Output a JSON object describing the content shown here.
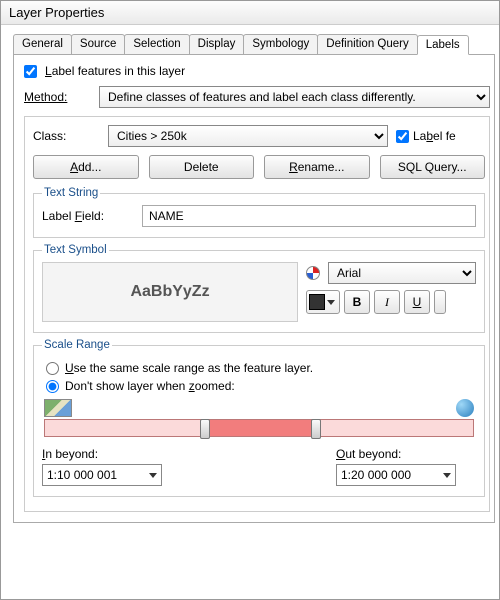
{
  "window": {
    "title": "Layer Properties"
  },
  "tabs": {
    "list": [
      "General",
      "Source",
      "Selection",
      "Display",
      "Symbology",
      "Definition Query",
      "Labels"
    ],
    "active": "Labels"
  },
  "labelFeatures": {
    "checked": true,
    "label": "Label features in this layer"
  },
  "method": {
    "label": "Method:",
    "value": "Define classes of features and label each class differently."
  },
  "class": {
    "label": "Class:",
    "value": "Cities > 250k",
    "labelFeaturesChk": "Label fe"
  },
  "buttons": {
    "add": "Add...",
    "delete": "Delete",
    "rename": "Rename...",
    "sql": "SQL Query..."
  },
  "textString": {
    "legend": "Text String",
    "labelFieldLabel": "Label Field:",
    "labelFieldValue": "NAME"
  },
  "textSymbol": {
    "legend": "Text Symbol",
    "preview": "AaBbYyZz",
    "font": "Arial",
    "bold": "B",
    "italic": "I",
    "underline": "U"
  },
  "scaleRange": {
    "legend": "Scale Range",
    "opt1": "Use the same scale range as the feature layer.",
    "opt2": "Don't show layer when zoomed:",
    "selected": 2,
    "inBeyondLabel": "In beyond:",
    "inBeyondValue": "1:10 000 001",
    "outBeyondLabel": "Out beyond:",
    "outBeyondValue": "1:20 000 000"
  }
}
